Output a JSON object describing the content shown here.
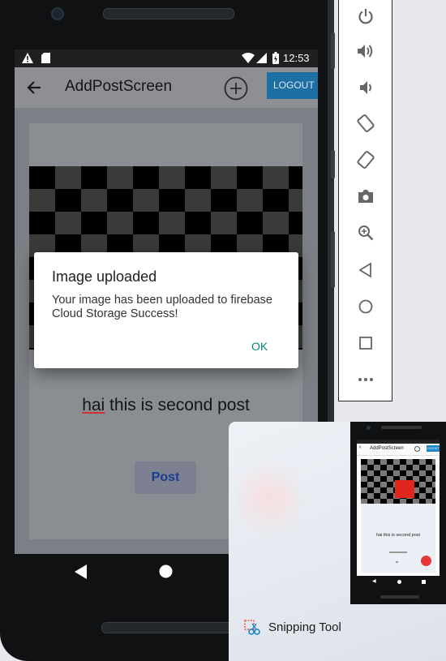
{
  "status_bar": {
    "time": "12:53"
  },
  "app": {
    "title": "AddPostScreen",
    "logout_label": "LOGOUT",
    "caption_text": "hai this is second post",
    "caption_first_word": "hai",
    "caption_rest": " this is second post",
    "post_label": "Post"
  },
  "dialog": {
    "title": "Image uploaded",
    "message": "Your image has been uploaded to firebase Cloud Storage Success!",
    "ok_label": "OK"
  },
  "emulator_toolbar": {
    "items": [
      "power-icon",
      "volume-up-icon",
      "volume-down-icon",
      "rotate-left-icon",
      "rotate-right-icon",
      "camera-icon",
      "zoom-icon",
      "back-icon",
      "home-icon",
      "overview-icon",
      "more-icon"
    ]
  },
  "snipping_tool": {
    "label": "Snipping Tool",
    "thumbnail": {
      "title": "AddPostScreen",
      "logout_label": "LOGOUT",
      "caption_text": "hai this is second post"
    }
  },
  "colors": {
    "accent": "#1e88c9",
    "ok_teal": "#00897b",
    "post_text": "#1b3c8f",
    "thumb_red": "#e0251c"
  }
}
